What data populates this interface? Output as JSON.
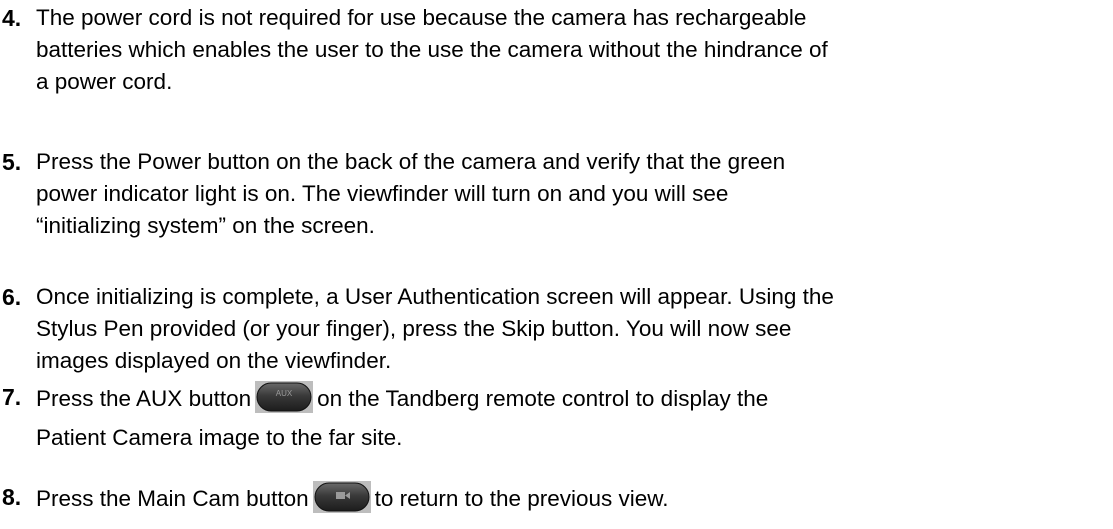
{
  "items": [
    {
      "number": "4.",
      "lines": [
        "The power cord is not required for use because the camera has rechargeable",
        "batteries which enables the user to the use the camera without the hindrance of",
        "a power cord."
      ]
    },
    {
      "number": "5.",
      "lines": [
        "Press the Power button on the back of the camera and verify that the green",
        "power indicator light is on.  The viewfinder will turn on and you will see",
        "“initializing system” on the screen."
      ]
    },
    {
      "number": "6.",
      "lines": [
        "Once initializing is complete, a User Authentication screen will appear.  Using the",
        "Stylus Pen provided (or your finger), press the Skip button.  You will now see",
        "images displayed on the viewfinder."
      ]
    },
    {
      "number": "7.",
      "line1_before": "Press the AUX button",
      "aux_icon_label": "AUX",
      "line1_after": "on the Tandberg remote control to display the",
      "line2": "Patient Camera image to the far site."
    },
    {
      "number": "8.",
      "line1_before": "Press the Main Cam button",
      "line1_after": "to return to the previous view."
    }
  ],
  "icons": {
    "aux_button": "aux-button-icon",
    "main_cam_button": "camera-button-icon"
  }
}
